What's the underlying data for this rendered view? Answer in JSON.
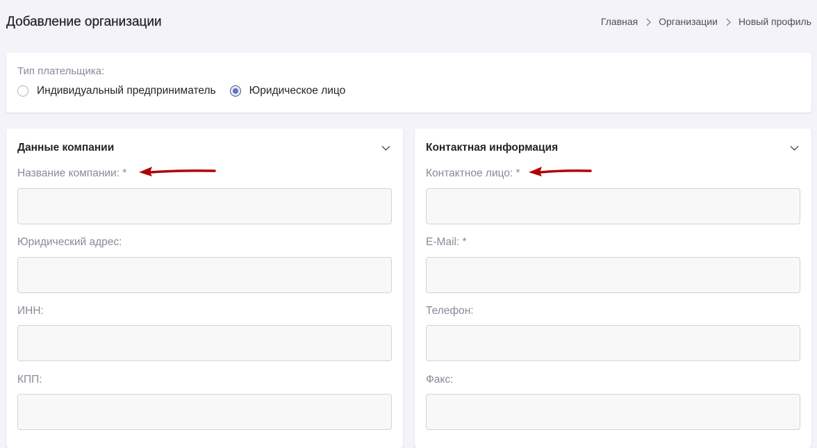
{
  "header": {
    "title": "Добавление организации",
    "breadcrumb": [
      "Главная",
      "Организации",
      "Новый профиль"
    ]
  },
  "payer": {
    "label": "Тип плательщика:",
    "options": [
      {
        "label": "Индивидуальный предприниматель",
        "checked": false
      },
      {
        "label": "Юридическое лицо",
        "checked": true
      }
    ]
  },
  "company": {
    "title": "Данные компании",
    "fields": [
      {
        "label": "Название компании: *",
        "value": "",
        "placeholder": ""
      },
      {
        "label": "Юридический адрес:",
        "value": "",
        "placeholder": ""
      },
      {
        "label": "ИНН:",
        "value": "",
        "placeholder": ""
      },
      {
        "label": "КПП:",
        "value": "",
        "placeholder": ""
      }
    ]
  },
  "contact": {
    "title": "Контактная информация",
    "fields": [
      {
        "label": "Контактное лицо: *",
        "value": "",
        "placeholder": ""
      },
      {
        "label": "E-Mail: *",
        "value": "",
        "placeholder": ""
      },
      {
        "label": "Телефон:",
        "value": "",
        "placeholder": ""
      },
      {
        "label": "Факс:",
        "value": "",
        "placeholder": ""
      }
    ]
  },
  "icons": {
    "breadcrumb_separator": "chevron-right-icon",
    "collapse": "chevron-down-icon",
    "annotation": "red-arrow-icon"
  },
  "colors": {
    "background": "#f3f3f9",
    "card": "#ffffff",
    "accent": "#405189",
    "radio_fill": "#6572b8",
    "label": "#878a99",
    "input_bg": "#f8f8f9",
    "arrow": "#b00000"
  }
}
